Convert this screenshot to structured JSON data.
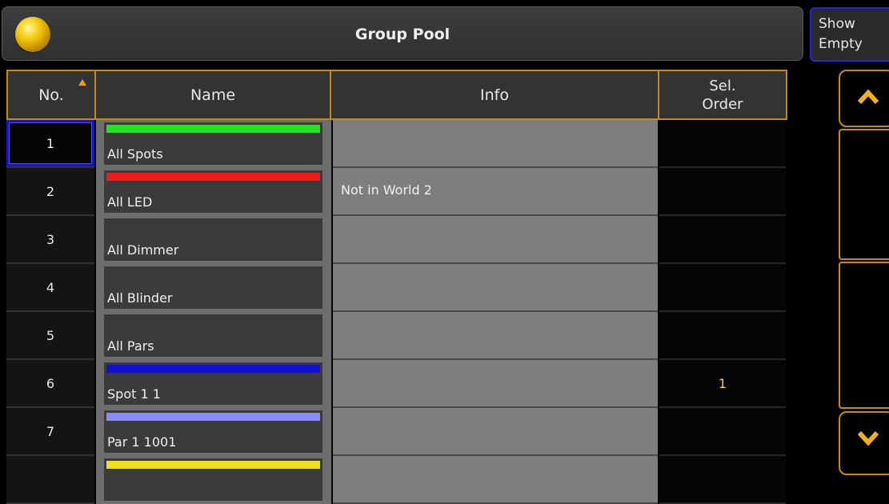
{
  "window": {
    "title": "Group Pool",
    "show_empty_label_line1": "Show",
    "show_empty_label_line2": "Empty"
  },
  "table": {
    "columns": [
      "No.",
      "Name",
      "Info",
      "Sel."
    ],
    "sel_order_line2": "Order",
    "sort_column": "No.",
    "rows": [
      {
        "no": "1",
        "name": "All Spots",
        "color": "#22e022",
        "info": "",
        "sel_order": ""
      },
      {
        "no": "2",
        "name": "All LED",
        "color": "#ee1c1c",
        "info": "Not in World 2",
        "sel_order": ""
      },
      {
        "no": "3",
        "name": "All Dimmer",
        "color": "",
        "info": "",
        "sel_order": ""
      },
      {
        "no": "4",
        "name": "All Blinder",
        "color": "",
        "info": "",
        "sel_order": ""
      },
      {
        "no": "5",
        "name": "All Pars",
        "color": "",
        "info": "",
        "sel_order": ""
      },
      {
        "no": "6",
        "name": "Spot 1 1",
        "color": "#1010d0",
        "info": "",
        "sel_order": "1"
      },
      {
        "no": "7",
        "name": "Par 1 1001",
        "color": "#8a8aff",
        "info": "",
        "sel_order": ""
      },
      {
        "no": "",
        "name": "",
        "color": "#f0e020",
        "info": "",
        "sel_order": ""
      }
    ]
  },
  "colors": {
    "accent_border": "#c38a1a",
    "selection": "#1616c8",
    "sel_order_text": "#f0d020"
  },
  "icons": {
    "scroll_up": "chevron-up-icon",
    "scroll_down": "chevron-down-icon",
    "sort": "sort-ascending-icon",
    "app": "grandma-bulb-icon"
  }
}
